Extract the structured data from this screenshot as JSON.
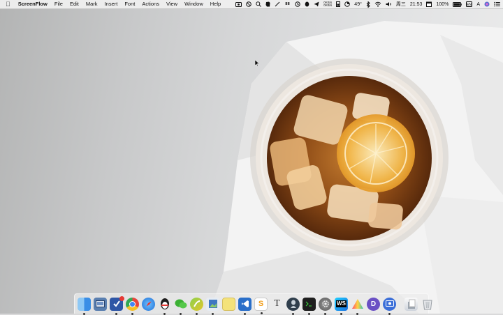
{
  "menubar": {
    "app_name": "ScreenFlow",
    "menus": [
      "File",
      "Edit",
      "Mark",
      "Insert",
      "Font",
      "Actions",
      "View",
      "Window",
      "Help"
    ],
    "status": {
      "network_up": "0KB/s",
      "network_down": "0KB/s",
      "temperature": "49°",
      "day": "周三",
      "time": "21:53",
      "battery": "100%",
      "input_method": "A"
    }
  },
  "dock": {
    "apps": [
      {
        "icon": "finder-icon",
        "color": "#3a8ee6"
      },
      {
        "icon": "screenshot-app-icon",
        "color": "#5a7fb0"
      },
      {
        "icon": "omnifocus-icon",
        "color": "#3d5fa8"
      },
      {
        "icon": "chrome-icon",
        "color": "#e8453c"
      },
      {
        "icon": "safari-icon",
        "color": "#2c84e8"
      },
      {
        "icon": "qq-icon",
        "color": "#1d1d1d"
      },
      {
        "icon": "wechat-icon",
        "color": "#3cb034"
      },
      {
        "icon": "maps-icon",
        "color": "#7bbf3a"
      },
      {
        "icon": "preview-icon",
        "color": "#3f78c2"
      },
      {
        "icon": "notes-icon",
        "color": "#f4e27a"
      },
      {
        "icon": "vscode-icon",
        "color": "#2a6fc9"
      },
      {
        "icon": "sketch-icon",
        "color": "#fff"
      },
      {
        "icon": "typora-icon",
        "color": "#ececec"
      },
      {
        "icon": "alfred-icon",
        "color": "#2f3e4c"
      },
      {
        "icon": "terminal-icon",
        "color": "#1e1e1e"
      },
      {
        "icon": "system-preferences-icon",
        "color": "#6b6b6b"
      },
      {
        "icon": "webstorm-icon",
        "color": "#11a2d8"
      },
      {
        "icon": "prism-icon",
        "color": "#eee"
      },
      {
        "icon": "dash-icon",
        "color": "#6a4fc4"
      },
      {
        "icon": "screenflow-icon",
        "color": "#3b6fd8"
      },
      {
        "icon": "downloads-stack-icon",
        "color": "#dfe3ea"
      },
      {
        "icon": "trash-icon",
        "color": "#d7d9dc"
      }
    ],
    "badge_count": ""
  }
}
